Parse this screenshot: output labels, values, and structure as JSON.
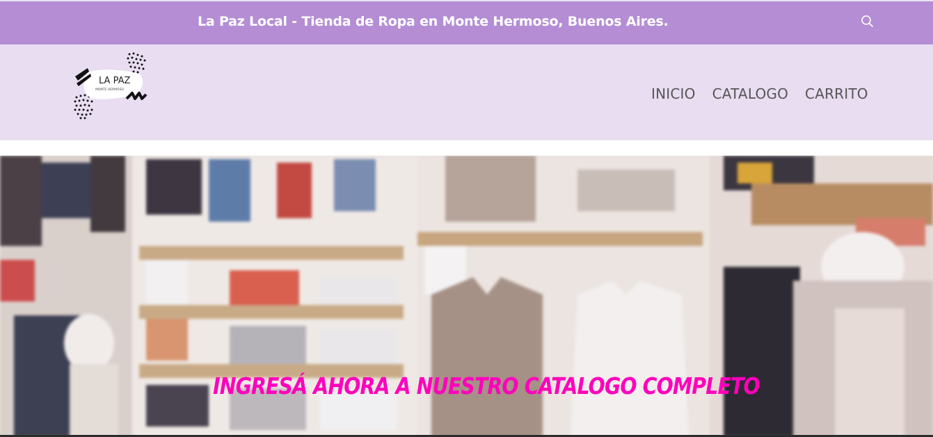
{
  "topbar": {
    "title": "La Paz Local - Tienda de Ropa en Monte Hermoso, Buenos Aires.",
    "search_icon": "search-icon",
    "background": "#b48dd4"
  },
  "header": {
    "background": "#e9ddf1",
    "logo": {
      "title": "LA PAZ",
      "subtitle": "MONTE HERMOSO"
    },
    "nav": [
      {
        "label": "INICIO"
      },
      {
        "label": "CATALOGO"
      },
      {
        "label": "CARRITO"
      }
    ]
  },
  "hero": {
    "headline": "INGRESÁ AHORA A NUESTRO CATALOGO COMPLETO",
    "headline_color": "#ff00bb"
  }
}
